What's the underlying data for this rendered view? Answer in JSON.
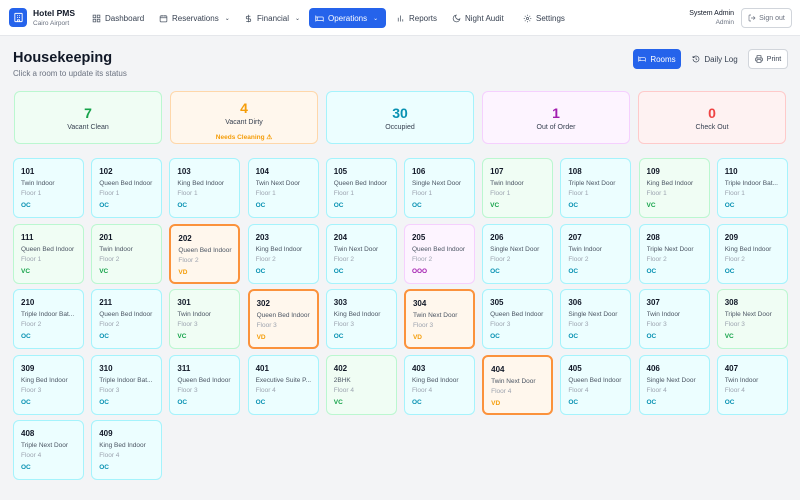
{
  "app": {
    "name": "Hotel PMS",
    "location": "Cairo Airport"
  },
  "nav": [
    {
      "key": "dashboard",
      "label": "Dashboard",
      "icon": "grid-icon",
      "dropdown": false,
      "active": false
    },
    {
      "key": "reservations",
      "label": "Reservations",
      "icon": "calendar-icon",
      "dropdown": true,
      "active": false
    },
    {
      "key": "financial",
      "label": "Financial",
      "icon": "dollar-icon",
      "dropdown": true,
      "active": false
    },
    {
      "key": "operations",
      "label": "Operations",
      "icon": "bed-icon",
      "dropdown": true,
      "active": true
    },
    {
      "key": "reports",
      "label": "Reports",
      "icon": "bar-chart-icon",
      "dropdown": false,
      "active": false
    },
    {
      "key": "night-audit",
      "label": "Night Audit",
      "icon": "moon-icon",
      "dropdown": false,
      "active": false
    },
    {
      "key": "settings",
      "label": "Settings",
      "icon": "gear-icon",
      "dropdown": false,
      "active": false
    }
  ],
  "user": {
    "name": "System Admin",
    "role": "Admin",
    "signout_label": "Sign out"
  },
  "page": {
    "title": "Housekeeping",
    "subtitle": "Click a room to update its status",
    "buttons": {
      "rooms": "Rooms",
      "daily_log": "Daily Log",
      "print": "Print"
    }
  },
  "stats": [
    {
      "key": "vc",
      "value": "7",
      "label": "Vacant Clean",
      "warning": ""
    },
    {
      "key": "vd",
      "value": "4",
      "label": "Vacant Dirty",
      "warning": "Needs Cleaning ⚠"
    },
    {
      "key": "oc",
      "value": "30",
      "label": "Occupied",
      "warning": ""
    },
    {
      "key": "ooo",
      "value": "1",
      "label": "Out of Order",
      "warning": ""
    },
    {
      "key": "co",
      "value": "0",
      "label": "Check Out",
      "warning": ""
    }
  ],
  "rooms": [
    {
      "number": "101",
      "type": "Twin Indoor",
      "floor": "Floor 1",
      "status": "OC"
    },
    {
      "number": "102",
      "type": "Queen Bed Indoor",
      "floor": "Floor 1",
      "status": "OC"
    },
    {
      "number": "103",
      "type": "King Bed Indoor",
      "floor": "Floor 1",
      "status": "OC"
    },
    {
      "number": "104",
      "type": "Twin Next Door",
      "floor": "Floor 1",
      "status": "OC"
    },
    {
      "number": "105",
      "type": "Queen Bed Indoor",
      "floor": "Floor 1",
      "status": "OC"
    },
    {
      "number": "106",
      "type": "Single Next Door",
      "floor": "Floor 1",
      "status": "OC"
    },
    {
      "number": "107",
      "type": "Twin Indoor",
      "floor": "Floor 1",
      "status": "VC"
    },
    {
      "number": "108",
      "type": "Triple Next Door",
      "floor": "Floor 1",
      "status": "OC"
    },
    {
      "number": "109",
      "type": "King Bed Indoor",
      "floor": "Floor 1",
      "status": "VC"
    },
    {
      "number": "110",
      "type": "Triple Indoor Bat...",
      "floor": "Floor 1",
      "status": "OC"
    },
    {
      "number": "111",
      "type": "Queen Bed Indoor",
      "floor": "Floor 1",
      "status": "VC"
    },
    {
      "number": "201",
      "type": "Twin Indoor",
      "floor": "Floor 2",
      "status": "VC"
    },
    {
      "number": "202",
      "type": "Queen Bed Indoor",
      "floor": "Floor 2",
      "status": "VD"
    },
    {
      "number": "203",
      "type": "King Bed Indoor",
      "floor": "Floor 2",
      "status": "OC"
    },
    {
      "number": "204",
      "type": "Twin Next Door",
      "floor": "Floor 2",
      "status": "OC"
    },
    {
      "number": "205",
      "type": "Queen Bed Indoor",
      "floor": "Floor 2",
      "status": "OOO"
    },
    {
      "number": "206",
      "type": "Single Next Door",
      "floor": "Floor 2",
      "status": "OC"
    },
    {
      "number": "207",
      "type": "Twin Indoor",
      "floor": "Floor 2",
      "status": "OC"
    },
    {
      "number": "208",
      "type": "Triple Next Door",
      "floor": "Floor 2",
      "status": "OC"
    },
    {
      "number": "209",
      "type": "King Bed Indoor",
      "floor": "Floor 2",
      "status": "OC"
    },
    {
      "number": "210",
      "type": "Triple Indoor Bat...",
      "floor": "Floor 2",
      "status": "OC"
    },
    {
      "number": "211",
      "type": "Queen Bed Indoor",
      "floor": "Floor 2",
      "status": "OC"
    },
    {
      "number": "301",
      "type": "Twin Indoor",
      "floor": "Floor 3",
      "status": "VC"
    },
    {
      "number": "302",
      "type": "Queen Bed Indoor",
      "floor": "Floor 3",
      "status": "VD"
    },
    {
      "number": "303",
      "type": "King Bed Indoor",
      "floor": "Floor 3",
      "status": "OC"
    },
    {
      "number": "304",
      "type": "Twin Next Door",
      "floor": "Floor 3",
      "status": "VD"
    },
    {
      "number": "305",
      "type": "Queen Bed Indoor",
      "floor": "Floor 3",
      "status": "OC"
    },
    {
      "number": "306",
      "type": "Single Next Door",
      "floor": "Floor 3",
      "status": "OC"
    },
    {
      "number": "307",
      "type": "Twin Indoor",
      "floor": "Floor 3",
      "status": "OC"
    },
    {
      "number": "308",
      "type": "Triple Next Door",
      "floor": "Floor 3",
      "status": "VC"
    },
    {
      "number": "309",
      "type": "King Bed Indoor",
      "floor": "Floor 3",
      "status": "OC"
    },
    {
      "number": "310",
      "type": "Triple Indoor Bat...",
      "floor": "Floor 3",
      "status": "OC"
    },
    {
      "number": "311",
      "type": "Queen Bed Indoor",
      "floor": "Floor 3",
      "status": "OC"
    },
    {
      "number": "401",
      "type": "Executive Suite P...",
      "floor": "Floor 4",
      "status": "OC"
    },
    {
      "number": "402",
      "type": "2BHK",
      "floor": "Floor 4",
      "status": "VC"
    },
    {
      "number": "403",
      "type": "King Bed Indoor",
      "floor": "Floor 4",
      "status": "OC"
    },
    {
      "number": "404",
      "type": "Twin Next Door",
      "floor": "Floor 4",
      "status": "VD"
    },
    {
      "number": "405",
      "type": "Queen Bed Indoor",
      "floor": "Floor 4",
      "status": "OC"
    },
    {
      "number": "406",
      "type": "Single Next Door",
      "floor": "Floor 4",
      "status": "OC"
    },
    {
      "number": "407",
      "type": "Twin Indoor",
      "floor": "Floor 4",
      "status": "OC"
    },
    {
      "number": "408",
      "type": "Triple Next Door",
      "floor": "Floor 4",
      "status": "OC"
    },
    {
      "number": "409",
      "type": "King Bed Indoor",
      "floor": "Floor 4",
      "status": "OC"
    }
  ],
  "colors": {
    "primary": "#2563eb",
    "vacant_clean": "#16a34a",
    "vacant_dirty": "#f59e0b",
    "occupied": "#0891b2",
    "out_of_order": "#a21caf",
    "check_out": "#ef4444"
  }
}
